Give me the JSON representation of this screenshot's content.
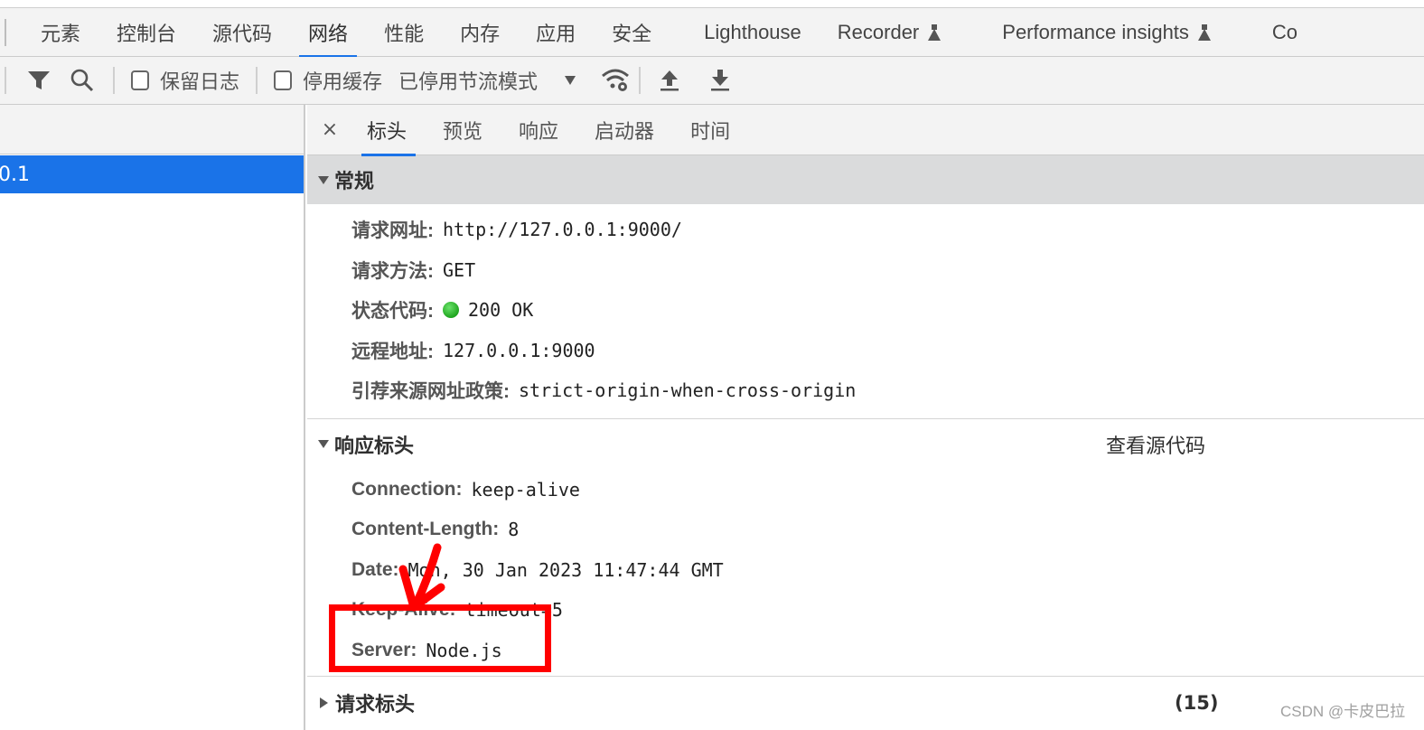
{
  "devtools": {
    "main_tabs": [
      {
        "label": "元素",
        "active": false
      },
      {
        "label": "控制台",
        "active": false
      },
      {
        "label": "源代码",
        "active": false
      },
      {
        "label": "网络",
        "active": true
      },
      {
        "label": "性能",
        "active": false
      },
      {
        "label": "内存",
        "active": false
      },
      {
        "label": "应用",
        "active": false
      },
      {
        "label": "安全",
        "active": false
      },
      {
        "label": "Lighthouse",
        "active": false
      },
      {
        "label": "Recorder",
        "active": false,
        "experimental": true
      },
      {
        "label": "Performance insights",
        "active": false,
        "experimental": true
      },
      {
        "label": "Co",
        "active": false
      }
    ],
    "toolbar": {
      "filter_icon": "filter-icon",
      "search_icon": "search-icon",
      "preserve_log_label": "保留日志",
      "preserve_log_checked": false,
      "disable_cache_label": "停用缓存",
      "disable_cache_checked": false,
      "throttling_value": "已停用节流模式",
      "network_conditions_icon": "wifi-gear-icon",
      "import_icon": "upload-icon",
      "export_icon": "download-icon"
    },
    "request_list": {
      "selected_request": "0.1"
    },
    "detail": {
      "close_label": "×",
      "sub_tabs": [
        {
          "label": "标头",
          "active": true
        },
        {
          "label": "预览",
          "active": false
        },
        {
          "label": "响应",
          "active": false
        },
        {
          "label": "启动器",
          "active": false
        },
        {
          "label": "时间",
          "active": false
        }
      ],
      "general": {
        "title": "常规",
        "rows": [
          {
            "name": "请求网址:",
            "value": "http://127.0.0.1:9000/"
          },
          {
            "name": "请求方法:",
            "value": "GET"
          },
          {
            "name": "状态代码:",
            "value": "200 OK",
            "status_color": "#22b022"
          },
          {
            "name": "远程地址:",
            "value": "127.0.0.1:9000"
          },
          {
            "name": "引荐来源网址政策:",
            "value": "strict-origin-when-cross-origin"
          }
        ]
      },
      "response_headers": {
        "title": "响应标头",
        "view_source_label": "查看源代码",
        "rows": [
          {
            "name": "Connection:",
            "value": "keep-alive"
          },
          {
            "name": "Content-Length:",
            "value": "8"
          },
          {
            "name": "Date:",
            "value": "Mon, 30 Jan 2023 11:47:44 GMT"
          },
          {
            "name": "Keep-Alive:",
            "value": "timeout=5"
          },
          {
            "name": "Server:",
            "value": "Node.js"
          }
        ]
      },
      "request_headers": {
        "title": "请求标头",
        "count": "(15)"
      }
    }
  },
  "annotation": {
    "highlight_color": "#ff0000",
    "highlighted_header": "Server: Node.js"
  },
  "watermark": "CSDN @卡皮巴拉",
  "colors": {
    "accent": "#1a73e8",
    "toolbar_bg": "#f3f3f3",
    "section_bg": "#dadbdc"
  }
}
